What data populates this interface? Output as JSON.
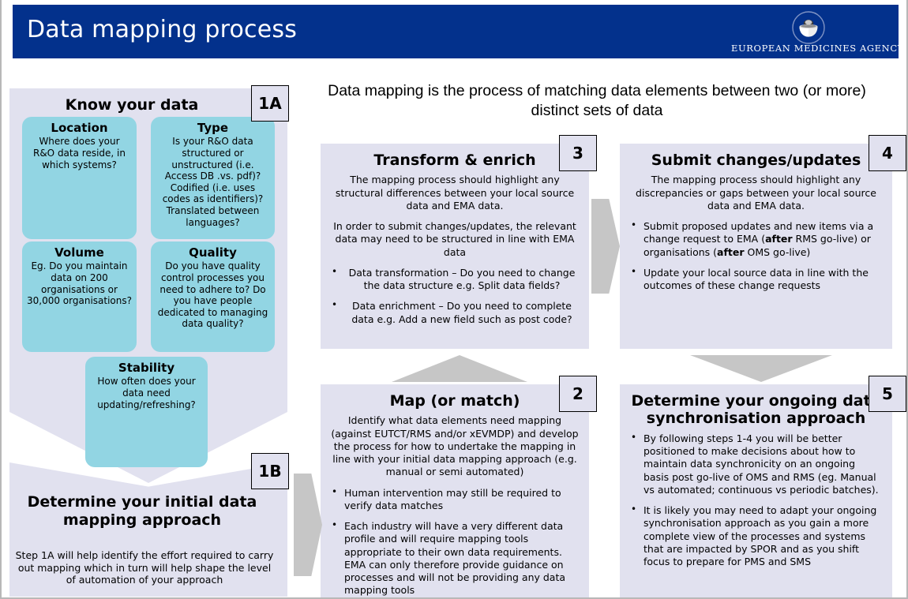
{
  "header": {
    "title": "Data mapping process",
    "logo_text": "EUROPEAN MEDICINES AGENCY",
    "brand_color": "#03318c"
  },
  "intro": {
    "text": "Data mapping is the process of matching data elements between two (or more) distinct sets of data"
  },
  "colors": {
    "panel_bg": "#e1e1ef",
    "kbox_bg": "#92d5e3",
    "arrow": "#c6c6c6",
    "header_bg": "#03318c"
  },
  "know_your_data": {
    "title": "Know your data",
    "badge": "1A",
    "boxes": [
      {
        "title": "Location",
        "body": "Where does your R&O data reside, in which systems?"
      },
      {
        "title": "Type",
        "body": "Is your R&O data structured or unstructured (i.e. Access DB .vs. pdf)? Codified (i.e. uses codes as identifiers)? Translated between languages?"
      },
      {
        "title": "Volume",
        "body": "Eg. Do you maintain data on 200 organisations or 30,000 organisations?"
      },
      {
        "title": "Quality",
        "body": "Do you have quality control processes you need to adhere to? Do you have people dedicated to managing data quality?"
      },
      {
        "title": "Stability",
        "body": "How often does your data need updating/refreshing?"
      }
    ]
  },
  "initial_approach": {
    "badge": "1B",
    "title": "Determine your initial data mapping approach",
    "body": "Step 1A will help identify the effort required to carry out mapping which in turn will help shape the level of automation of your approach"
  },
  "steps": {
    "step2": {
      "badge": "2",
      "title": "Map (or match)",
      "paragraphs": [
        "Identify what data elements need mapping (against EUTCT/RMS and/or xEVMDP) and develop the process for how to undertake the mapping in line with your initial data mapping approach (e.g. manual or semi automated)"
      ],
      "bullets": [
        "Human intervention may still be required to verify data matches",
        "Each industry will have a very different data profile and will require mapping tools appropriate to their own data requirements. EMA can only therefore provide guidance on processes and will not be providing any data mapping tools"
      ]
    },
    "step3": {
      "badge": "3",
      "title": "Transform & enrich",
      "paragraphs": [
        "The mapping process should highlight any structural differences between your local source data and EMA data.",
        "In order to submit changes/updates, the relevant data may need to be structured in line with EMA data"
      ],
      "bullets": [
        "Data transformation – Do you need to change the data structure e.g. Split data fields?",
        "Data enrichment – Do you need to complete data e.g. Add a new field such as post code?"
      ]
    },
    "step4": {
      "badge": "4",
      "title": "Submit changes/updates",
      "paragraphs": [
        "The mapping process should highlight any discrepancies or gaps between your local source data and EMA data."
      ],
      "bullets_html": [
        "Submit proposed updates and new items via a change request to EMA (<b>after</b> RMS go-live) or organisations (<b>after</b> OMS go-live)",
        "Update your local source data in line with the outcomes of these change requests"
      ]
    },
    "step5": {
      "badge": "5",
      "title": "Determine your ongoing data synchronisation approach",
      "paragraphs": [],
      "bullets": [
        "By following steps 1-4 you will be better positioned to make decisions about how to maintain data synchronicity on an ongoing basis post go-live of OMS and RMS (eg. Manual vs automated; continuous vs periodic batches).",
        "It is likely you may need to adapt your ongoing synchronisation approach as you gain a more complete view of the processes and systems that are impacted by SPOR and as you shift focus to prepare for PMS and SMS"
      ]
    }
  }
}
